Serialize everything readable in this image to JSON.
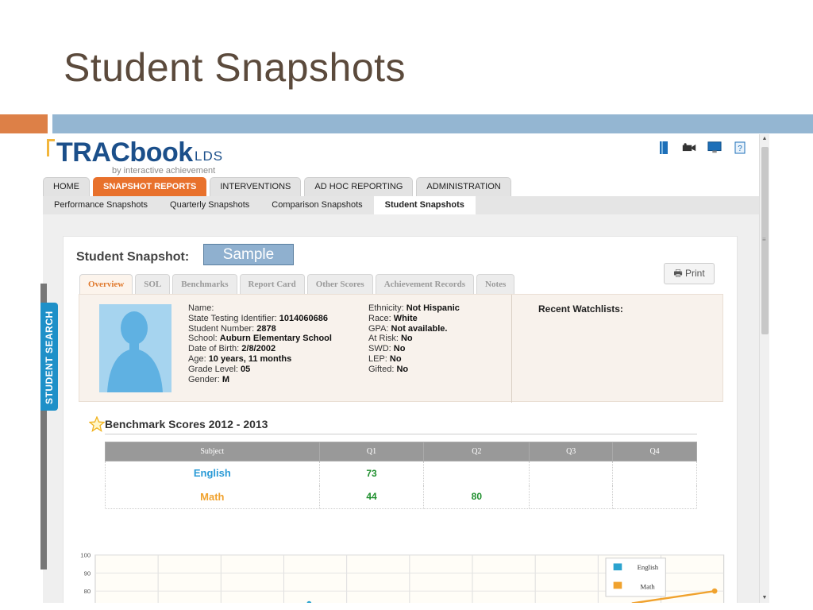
{
  "slide": {
    "title": "Student Snapshots"
  },
  "app": {
    "logo_main": "TRACbook",
    "logo_suffix": "LDS",
    "logo_sub": "by interactive achievement"
  },
  "main_tabs": [
    {
      "label": "HOME"
    },
    {
      "label": "SNAPSHOT REPORTS",
      "active": true
    },
    {
      "label": "INTERVENTIONS"
    },
    {
      "label": "AD HOC REPORTING"
    },
    {
      "label": "ADMINISTRATION"
    }
  ],
  "sub_nav": [
    {
      "label": "Performance Snapshots"
    },
    {
      "label": "Quarterly Snapshots"
    },
    {
      "label": "Comparison Snapshots"
    },
    {
      "label": "Student Snapshots",
      "active": true
    }
  ],
  "sidebar": {
    "search_label": "STUDENT SEARCH"
  },
  "snapshot": {
    "title": "Student Snapshot: ",
    "sample_label": "Sample",
    "print_label": "Print"
  },
  "snapshot_tabs": [
    {
      "label": "Overview",
      "active": true
    },
    {
      "label": "SOL"
    },
    {
      "label": "Benchmarks"
    },
    {
      "label": "Report Card"
    },
    {
      "label": "Other Scores"
    },
    {
      "label": "Achievement Records"
    },
    {
      "label": "Notes"
    }
  ],
  "profile": {
    "left": [
      {
        "label": "Name: ",
        "value": ""
      },
      {
        "label": "State Testing Identifier: ",
        "value": "1014060686"
      },
      {
        "label": "Student Number: ",
        "value": "2878"
      },
      {
        "label": "School: ",
        "value": "Auburn Elementary School"
      },
      {
        "label": "Date of Birth: ",
        "value": "2/8/2002"
      },
      {
        "label": "Age: ",
        "value": "10 years, 11 months"
      },
      {
        "label": "Grade Level: ",
        "value": "05"
      },
      {
        "label": "Gender: ",
        "value": "M"
      }
    ],
    "right": [
      {
        "label": "Ethnicity: ",
        "value": "Not Hispanic"
      },
      {
        "label": "Race: ",
        "value": "White"
      },
      {
        "label": "GPA: ",
        "value": "Not available."
      },
      {
        "label": "At Risk: ",
        "value": "No"
      },
      {
        "label": "SWD: ",
        "value": "No"
      },
      {
        "label": "LEP: ",
        "value": "No"
      },
      {
        "label": "Gifted: ",
        "value": "No"
      }
    ],
    "watchlists_label": "Recent Watchlists:"
  },
  "benchmark": {
    "title": "Benchmark Scores 2012 - 2013",
    "headers": [
      "Subject",
      "Q1",
      "Q2",
      "Q3",
      "Q4"
    ],
    "rows": [
      {
        "subject": "English",
        "q1": "73",
        "q2": "",
        "q3": "",
        "q4": ""
      },
      {
        "subject": "Math",
        "q1": "44",
        "q2": "80",
        "q3": "",
        "q4": ""
      }
    ]
  },
  "chart_data": {
    "type": "line",
    "y_ticks": [
      "100",
      "90",
      "80"
    ],
    "ylim": [
      70,
      100
    ],
    "series": [
      {
        "name": "English",
        "color": "#2ba3cf",
        "values": [
          73
        ]
      },
      {
        "name": "Math",
        "color": "#f0a22e",
        "values": [
          44,
          80
        ]
      }
    ]
  },
  "colors": {
    "accent_orange": "#e8712c",
    "brand_blue": "#1b4f8a",
    "search_blue": "#1e90c8"
  }
}
